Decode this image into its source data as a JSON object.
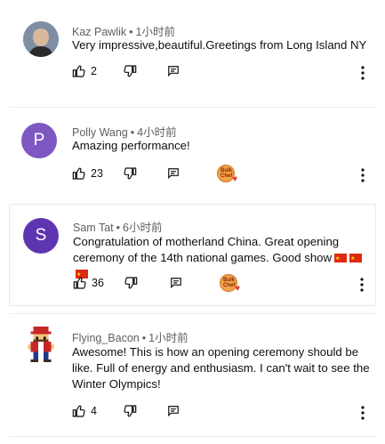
{
  "comments": [
    {
      "author": "Kaz Pawlik",
      "time": "1小时前",
      "text": "Very impressive,beautiful.Greetings from Long Island NY",
      "likes": "2",
      "avatar_letter": "",
      "avatar_color": "#6b7a8f",
      "hearted": false
    },
    {
      "author": "Polly Wang",
      "time": "4小时前",
      "text": "Amazing performance!",
      "likes": "23",
      "avatar_letter": "P",
      "avatar_color": "#7e57c2",
      "hearted": true
    },
    {
      "author": "Sam Tat",
      "time": "6小时前",
      "text_line1": "Congratulation of motherland China. Great opening",
      "text_line2": "ceremony of the 14th national games. Good show",
      "likes": "36",
      "avatar_letter": "S",
      "avatar_color": "#5e35b1",
      "hearted": true
    },
    {
      "author": "Flying_Bacon",
      "time": "1小时前",
      "text": "Awesome! This is how an opening ceremony should be like. Full of energy and enthusiasm. I can't wait to see the Winter Olympics!",
      "likes": "4",
      "avatar_letter": "",
      "avatar_color": "#ffffff",
      "hearted": false
    }
  ],
  "dot": "•",
  "badge_text": "Bulk Chef",
  "heart": "♥"
}
